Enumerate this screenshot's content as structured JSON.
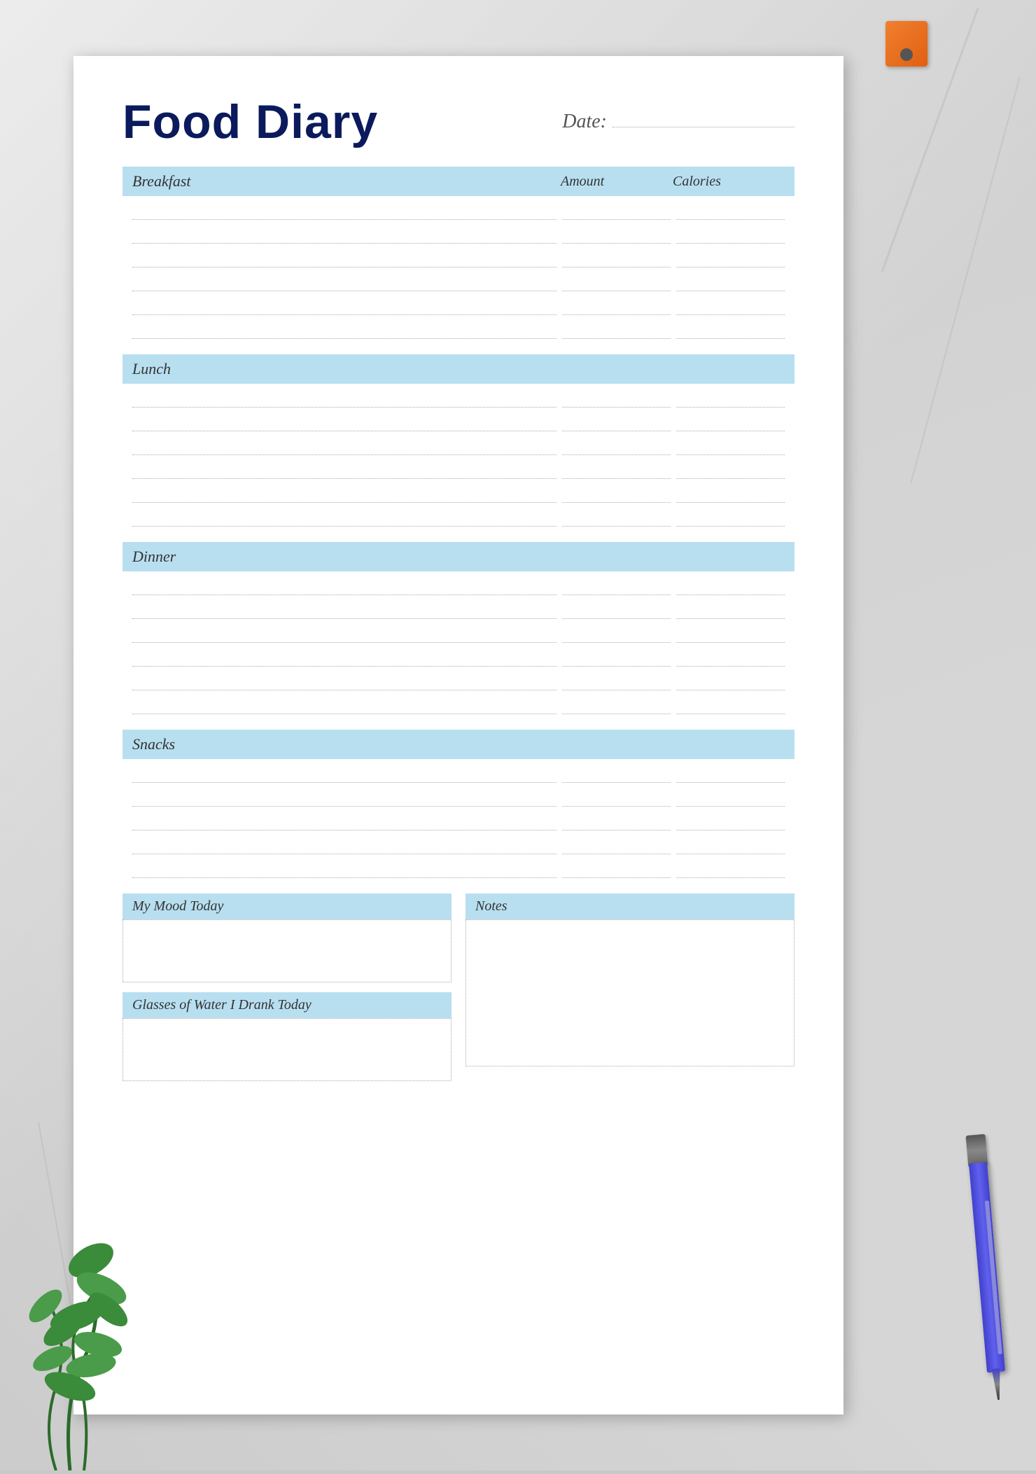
{
  "background": {
    "color": "#d2d2d2"
  },
  "title": "Food Diary",
  "date_label": "Date:",
  "sections": [
    {
      "id": "breakfast",
      "label": "Breakfast",
      "col_amount": "Amount",
      "col_calories": "Calories",
      "rows": 6
    },
    {
      "id": "lunch",
      "label": "Lunch",
      "rows": 6
    },
    {
      "id": "dinner",
      "label": "Dinner",
      "rows": 6
    },
    {
      "id": "snacks",
      "label": "Snacks",
      "rows": 5
    }
  ],
  "bottom_left": [
    {
      "id": "mood",
      "label": "My Mood Today"
    },
    {
      "id": "water",
      "label": "Glasses of Water I Drank Today"
    }
  ],
  "bottom_right": {
    "id": "notes",
    "label": "Notes"
  }
}
